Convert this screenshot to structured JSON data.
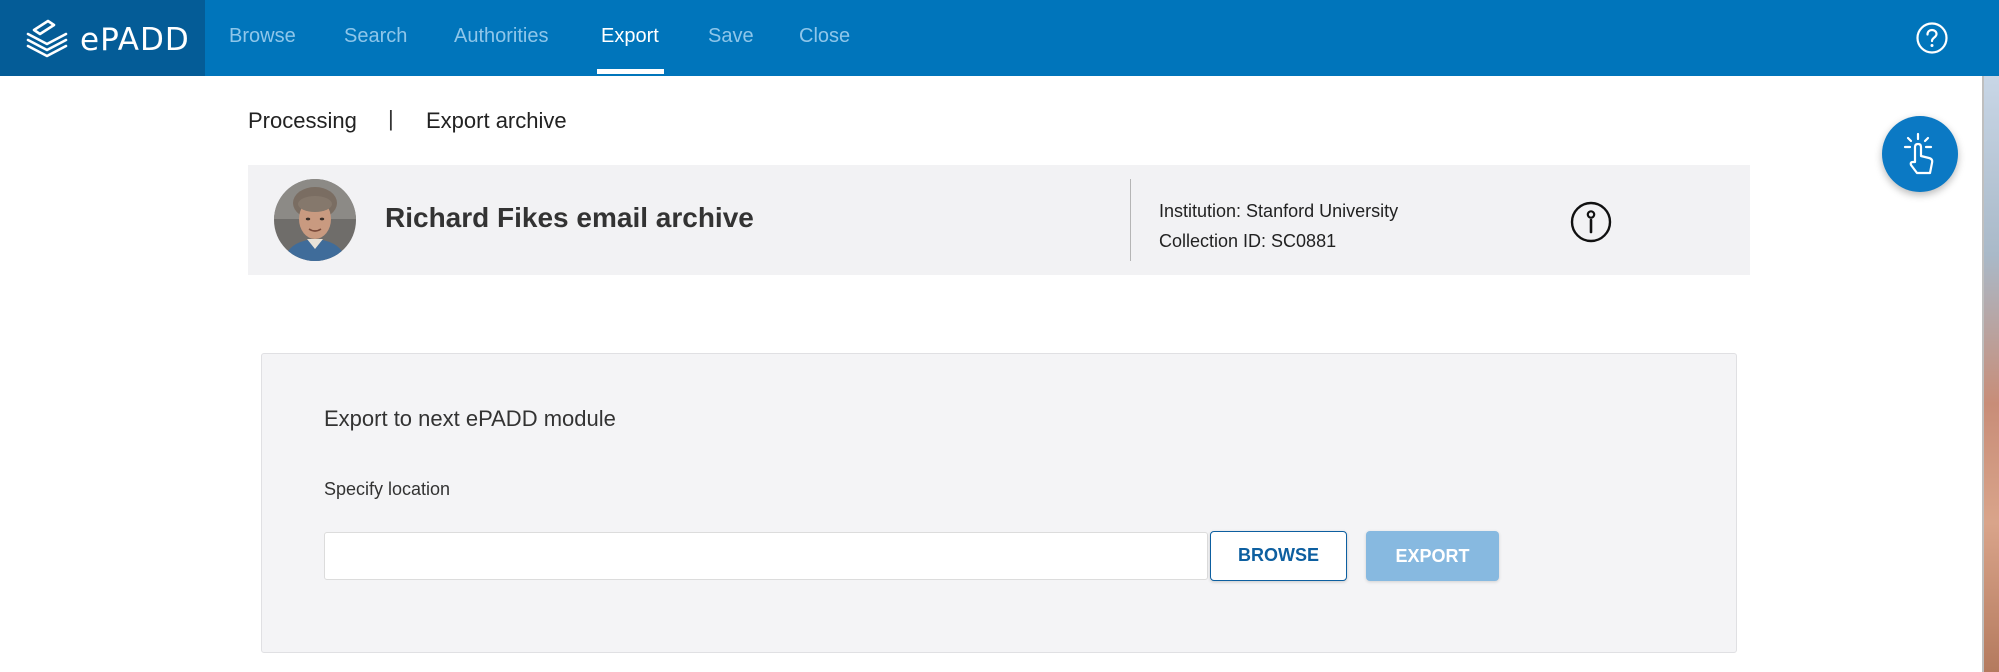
{
  "app": {
    "logo_text": "ePADD"
  },
  "nav": {
    "items": [
      {
        "label": "Browse",
        "active": false
      },
      {
        "label": "Search",
        "active": false
      },
      {
        "label": "Authorities",
        "active": false
      },
      {
        "label": "Export",
        "active": true
      },
      {
        "label": "Save",
        "active": false
      },
      {
        "label": "Close",
        "active": false
      }
    ],
    "help_icon": "question-circle-icon"
  },
  "breadcrumb": {
    "items": [
      "Processing",
      "Export archive"
    ],
    "separator": "|"
  },
  "archive": {
    "title": "Richard Fikes email archive",
    "institution": "Institution: Stanford University",
    "collection_id": "Collection ID: SC0881",
    "info_icon": "info-circle-icon"
  },
  "fab": {
    "icon": "tap-hand-icon"
  },
  "export_panel": {
    "heading": "Export to next ePADD module",
    "location_label": "Specify location",
    "location_value": "",
    "browse_label": "BROWSE",
    "export_label": "EXPORT"
  },
  "colors": {
    "nav_background": "#0075bb",
    "logo_background": "#045c97",
    "nav_inactive_text": "#8ec6ea",
    "card_background": "#f2f2f4",
    "fab_background": "#0b79c4",
    "browse_border": "#0d5fa0",
    "export_disabled": "#87b9e0"
  }
}
